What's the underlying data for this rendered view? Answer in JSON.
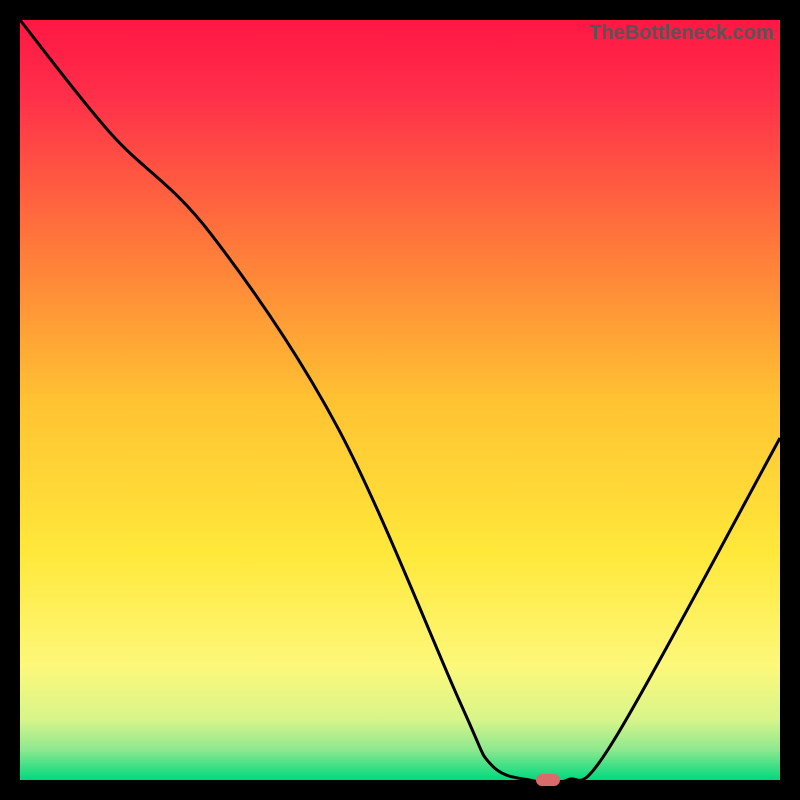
{
  "watermark": "TheBottleneck.com",
  "chart_data": {
    "type": "line",
    "title": "",
    "xlabel": "",
    "ylabel": "",
    "xlim": [
      0,
      100
    ],
    "ylim": [
      0,
      100
    ],
    "series": [
      {
        "name": "bottleneck-curve",
        "x": [
          0,
          12,
          25,
          42,
          58,
          62,
          67,
          72,
          78,
          100
        ],
        "values": [
          100,
          85,
          72,
          46,
          10,
          2,
          0,
          0,
          5,
          45
        ]
      }
    ],
    "marker": {
      "x": 69.5,
      "y": 0,
      "color": "#d96b6b"
    },
    "gradient_stops": [
      {
        "offset": 0,
        "color": "#ff1744"
      },
      {
        "offset": 0.1,
        "color": "#ff2f4a"
      },
      {
        "offset": 0.3,
        "color": "#ff7a3a"
      },
      {
        "offset": 0.5,
        "color": "#ffc232"
      },
      {
        "offset": 0.7,
        "color": "#ffe83a"
      },
      {
        "offset": 0.85,
        "color": "#fdf87a"
      },
      {
        "offset": 0.92,
        "color": "#d8f58a"
      },
      {
        "offset": 0.96,
        "color": "#8ee88f"
      },
      {
        "offset": 1.0,
        "color": "#00d97e"
      }
    ],
    "curve_color": "#000000",
    "curve_width": 3
  }
}
